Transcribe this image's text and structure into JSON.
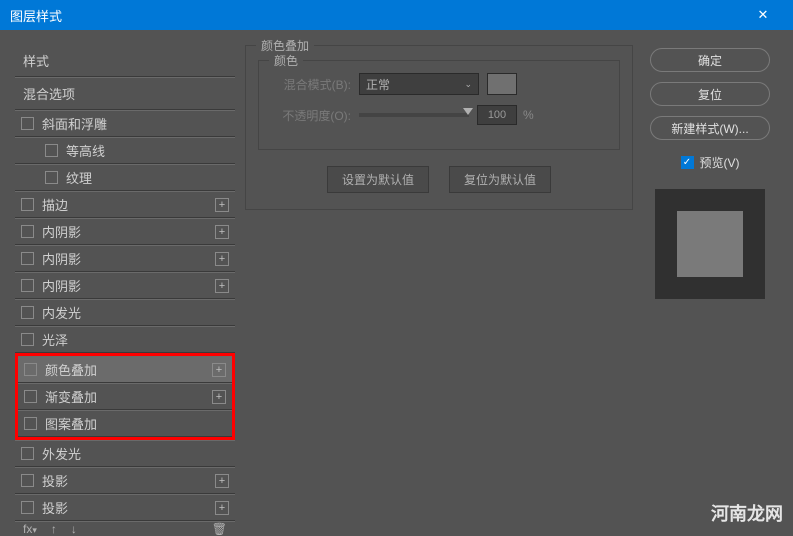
{
  "window": {
    "title": "图层样式",
    "close": "✕"
  },
  "left": {
    "header1": "样式",
    "header2": "混合选项",
    "items": [
      {
        "label": "斜面和浮雕",
        "add": false,
        "indent": false
      },
      {
        "label": "等高线",
        "add": false,
        "indent": true
      },
      {
        "label": "纹理",
        "add": false,
        "indent": true
      },
      {
        "label": "描边",
        "add": true,
        "indent": false
      },
      {
        "label": "内阴影",
        "add": true,
        "indent": false
      },
      {
        "label": "内阴影",
        "add": true,
        "indent": false
      },
      {
        "label": "内阴影",
        "add": true,
        "indent": false
      },
      {
        "label": "内发光",
        "add": false,
        "indent": false
      },
      {
        "label": "光泽",
        "add": false,
        "indent": false
      },
      {
        "label": "颜色叠加",
        "add": true,
        "indent": false,
        "selected": true,
        "hl": "top"
      },
      {
        "label": "渐变叠加",
        "add": true,
        "indent": false,
        "hl": "mid"
      },
      {
        "label": "图案叠加",
        "add": false,
        "indent": false,
        "hl": "bot"
      },
      {
        "label": "外发光",
        "add": false,
        "indent": false
      },
      {
        "label": "投影",
        "add": true,
        "indent": false
      },
      {
        "label": "投影",
        "add": true,
        "indent": false
      }
    ],
    "bottom": {
      "fx": "fx",
      "trash": "🗑"
    }
  },
  "center": {
    "group_title": "颜色叠加",
    "inner_title": "颜色",
    "blend_label": "混合模式(B):",
    "blend_value": "正常",
    "opacity_label": "不透明度(O):",
    "opacity_value": "100",
    "pct": "%",
    "btn_default": "设置为默认值",
    "btn_reset": "复位为默认值"
  },
  "right": {
    "ok": "确定",
    "cancel": "复位",
    "new_style": "新建样式(W)...",
    "preview": "预览(V)"
  },
  "watermark": "河南龙网"
}
